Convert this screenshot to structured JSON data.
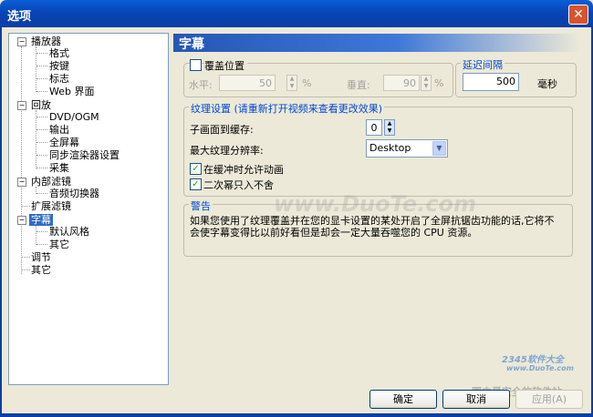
{
  "window": {
    "title": "选项",
    "close_glyph": "✕"
  },
  "tree": [
    {
      "label": "播放器",
      "expander": "−"
    },
    {
      "label": "格式"
    },
    {
      "label": "按键"
    },
    {
      "label": "标志"
    },
    {
      "label": "Web 界面"
    },
    {
      "label": "回放",
      "expander": "−"
    },
    {
      "label": "DVD/OGM"
    },
    {
      "label": "输出"
    },
    {
      "label": "全屏幕"
    },
    {
      "label": "同步渲染器设置"
    },
    {
      "label": "采集"
    },
    {
      "label": "内部滤镜",
      "expander": "−"
    },
    {
      "label": "音频切换器"
    },
    {
      "label": "扩展滤镜"
    },
    {
      "label": "字幕",
      "expander": "−",
      "selected": true
    },
    {
      "label": "默认风格"
    },
    {
      "label": "其它"
    },
    {
      "label": "调节"
    },
    {
      "label": "其它"
    }
  ],
  "panel": {
    "title": "字幕"
  },
  "position": {
    "override_label": "覆盖位置",
    "override_checked": false,
    "horizontal_label": "水平:",
    "horizontal_value": "50",
    "horizontal_unit": "%",
    "vertical_label": "垂直:",
    "vertical_value": "90",
    "vertical_unit": "%"
  },
  "delay": {
    "group_label": "延迟间隔",
    "value": "500",
    "unit": "毫秒"
  },
  "texture": {
    "group_label": "纹理设置 (请重新打开视频来查看更改效果)",
    "buffer_label": "子画面到缓存:",
    "buffer_value": "0",
    "max_res_label": "最大纹理分辨率:",
    "max_res_value": "Desktop",
    "allow_anim_label": "在缓冲时允许动画",
    "allow_anim_checked": true,
    "pow2_label": "二次幂只入不舍",
    "pow2_checked": true
  },
  "warning": {
    "group_label": "警告",
    "text": "如果您使用了纹理覆盖并在您的显卡设置的某处开启了全屏抗锯齿功能的话,它将不会使字幕变得比以前好看但是却会一定大量吞噬您的 CPU 资源。"
  },
  "buttons": {
    "ok": "确定",
    "cancel": "取消",
    "apply": "应用(A)"
  },
  "watermarks": {
    "main": "www.DuoTe.com",
    "brand": "2345软件大全",
    "url": "www.DuoTe.com",
    "footer": "国内最安全的软件站"
  }
}
